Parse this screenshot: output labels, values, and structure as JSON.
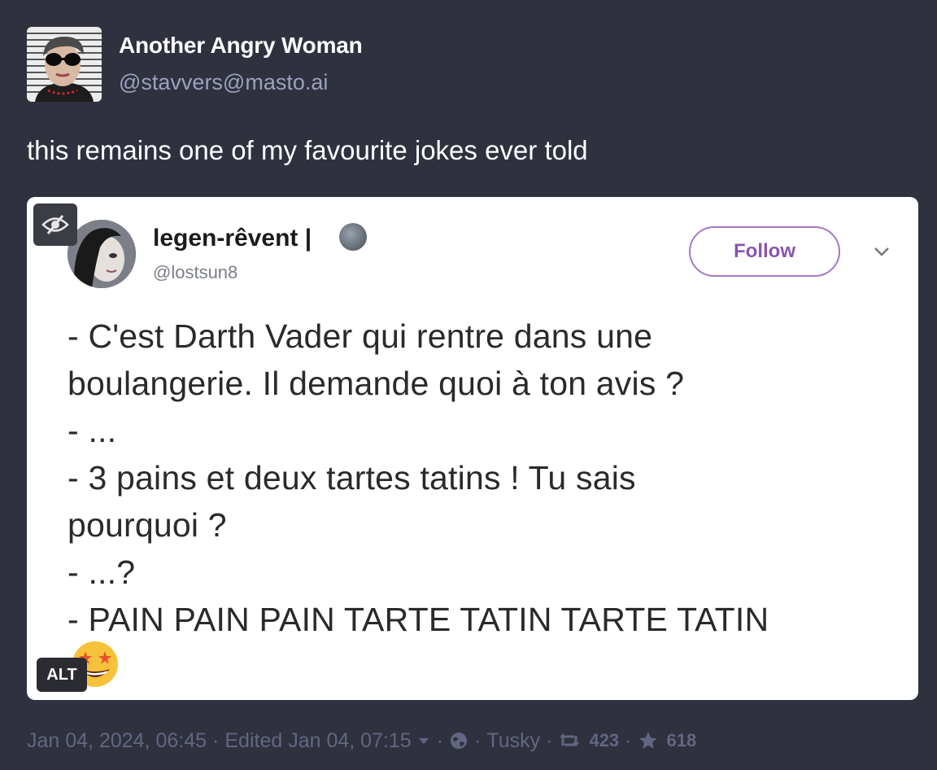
{
  "author": {
    "display_name": "Another Angry Woman",
    "handle": "@stavvers@masto.ai"
  },
  "post_text": "this remains one of my favourite jokes ever told",
  "media": {
    "alt_label": "ALT",
    "embedded_tweet": {
      "name": "legen-rêvent |",
      "handle": "@lostsun8",
      "follow_label": "Follow",
      "text": "- C'est Darth Vader qui rentre dans une\nboulangerie. Il demande quoi à ton avis ?\n- ...\n- 3 pains et deux tartes tatins ! Tu sais\npourquoi ?\n- ...?\n- PAIN PAIN PAIN TARTE TATIN TARTE TATIN",
      "emoji_icon": "star-struck-emoji"
    }
  },
  "meta": {
    "timestamp": "Jan 04, 2024, 06:45",
    "edited": "Edited Jan 04, 07:15",
    "visibility_icon": "globe-icon",
    "client": "Tusky",
    "boosts": "423",
    "favourites": "618"
  },
  "colors": {
    "background": "#2f313f",
    "muted_text": "#626781",
    "handle_text": "#9ba1bd",
    "follow_accent": "#8a55ae"
  }
}
